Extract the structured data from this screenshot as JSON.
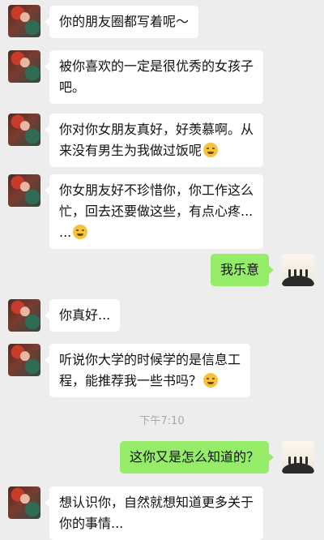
{
  "messages": [
    {
      "side": "left",
      "lines": [
        "你的朋友圈都写着呢～"
      ]
    },
    {
      "side": "left",
      "lines": [
        "被你喜欢的一定是很优秀的女孩子",
        "吧。"
      ]
    },
    {
      "side": "left",
      "lines": [
        "你对你女朋友真好，好羡慕啊。从",
        "来没有男生为我做过饭呢"
      ],
      "emoji": "smiling-tears-emoji"
    },
    {
      "side": "left",
      "lines": [
        "你女朋友好不珍惜你，你工作这么",
        "忙，回去还要做这些，有点心疼...",
        "..."
      ],
      "emoji": "sad-emoji"
    },
    {
      "side": "right",
      "lines": [
        "我乐意"
      ]
    },
    {
      "side": "left",
      "lines": [
        "你真好..."
      ]
    },
    {
      "side": "left",
      "lines": [
        "听说你大学的时候学的是信息工",
        "程，能推荐我一些书吗？"
      ],
      "emoji": "grin-emoji"
    },
    {
      "side": "right",
      "lines": [
        "这你又是怎么知道的？"
      ]
    },
    {
      "side": "left",
      "lines": [
        "想认识你，自然就想知道更多关于",
        "你的事情..."
      ]
    }
  ],
  "timestamp": "下午7:10"
}
